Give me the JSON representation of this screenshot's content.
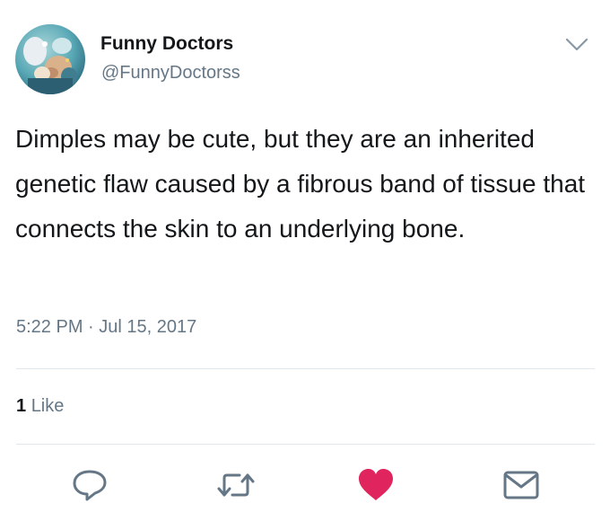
{
  "user": {
    "display_name": "Funny Doctors",
    "handle": "@FunnyDoctorss"
  },
  "tweet": {
    "text": "Dimples may be cute, but they are an inherited genetic flaw caused by a fibrous band of tissue that connects the skin to an underlying bone.",
    "timestamp": "5:22 PM · Jul 15, 2017"
  },
  "stats": {
    "likes_count": "1",
    "likes_label": "Like"
  },
  "actions": {
    "reply_icon": "reply-icon",
    "retweet_icon": "retweet-icon",
    "like_icon": "heart-icon",
    "message_icon": "envelope-icon"
  },
  "colors": {
    "text": "#14171a",
    "secondary": "#657786",
    "divider": "#e1e8ed",
    "like": "#e0245e",
    "icon": "#657786"
  }
}
